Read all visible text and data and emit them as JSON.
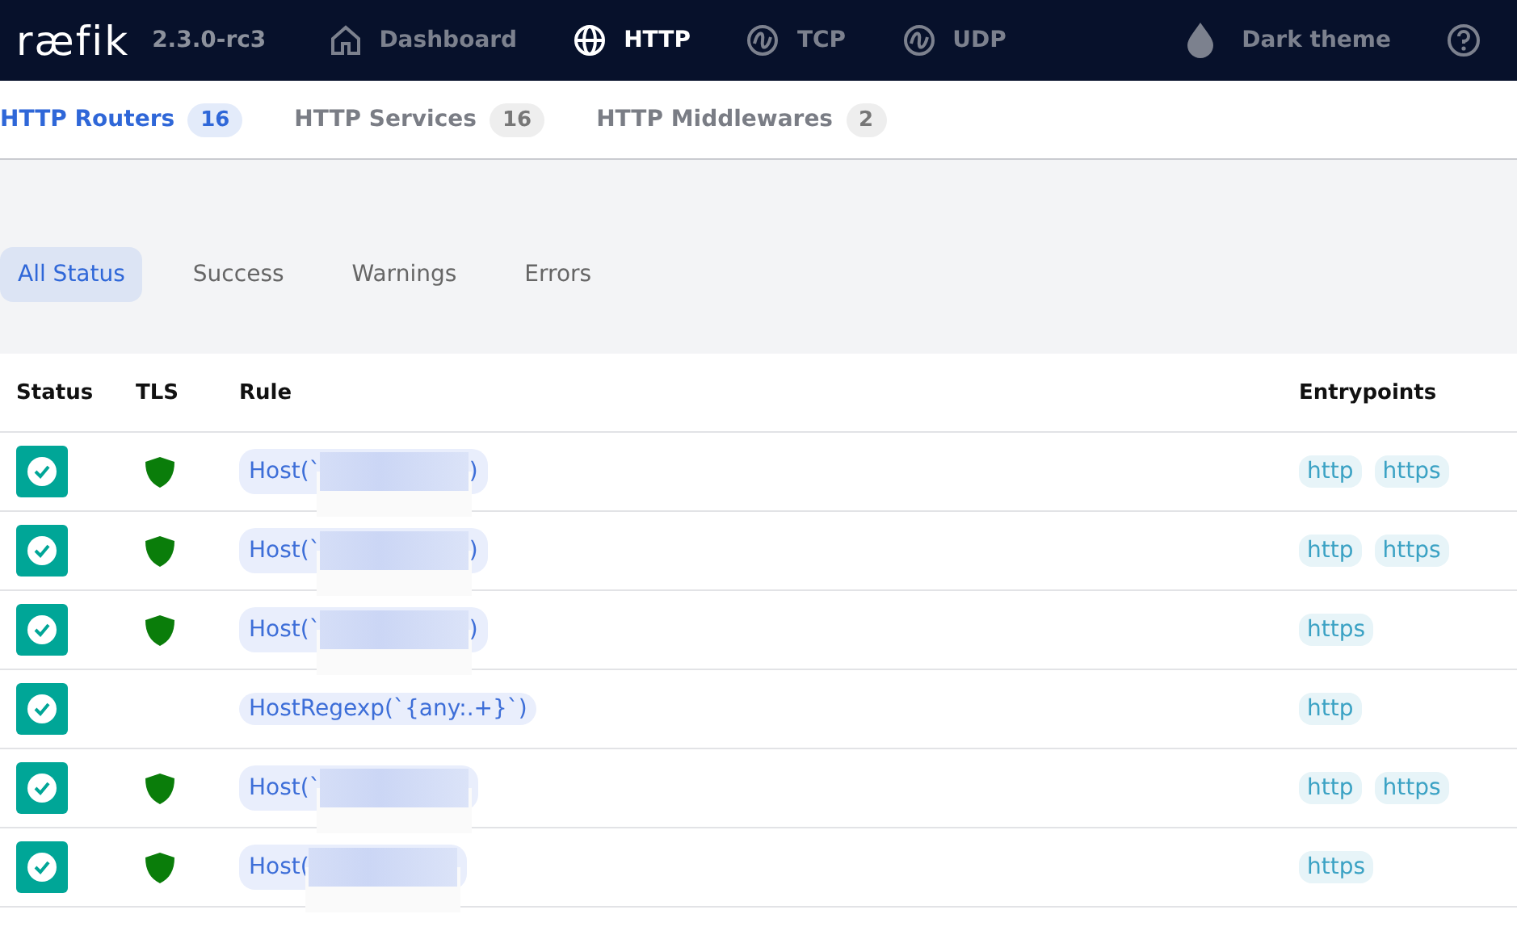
{
  "navbar": {
    "logo": "ræfik",
    "version": "2.3.0-rc3",
    "items": [
      {
        "label": "Dashboard",
        "selected": false
      },
      {
        "label": "HTTP",
        "selected": true
      },
      {
        "label": "TCP",
        "selected": false
      },
      {
        "label": "UDP",
        "selected": false
      }
    ],
    "theme_toggle": "Dark theme"
  },
  "subtabs": [
    {
      "label": "HTTP Routers",
      "count": "16",
      "selected": true
    },
    {
      "label": "HTTP Services",
      "count": "16",
      "selected": false
    },
    {
      "label": "HTTP Middlewares",
      "count": "2",
      "selected": false
    }
  ],
  "filters": [
    {
      "label": "All Status",
      "selected": true
    },
    {
      "label": "Success",
      "selected": false
    },
    {
      "label": "Warnings",
      "selected": false
    },
    {
      "label": "Errors",
      "selected": false
    }
  ],
  "table": {
    "columns": [
      "Status",
      "TLS",
      "Rule",
      "Entrypoints"
    ],
    "rows": [
      {
        "success": true,
        "tls": true,
        "rule": "Host(`",
        "redacted": true,
        "rule_end": ")",
        "entrypoints": [
          "http",
          "https"
        ]
      },
      {
        "success": true,
        "tls": true,
        "rule": "Host(`",
        "redacted": true,
        "rule_end": ")",
        "entrypoints": [
          "http",
          "https"
        ]
      },
      {
        "success": true,
        "tls": true,
        "rule": "Host(`",
        "redacted": true,
        "rule_end": ")",
        "entrypoints": [
          "https"
        ]
      },
      {
        "success": true,
        "tls": false,
        "rule": "HostRegexp(`{any:.+}`)",
        "redacted": false,
        "entrypoints": [
          "http"
        ]
      },
      {
        "success": true,
        "tls": true,
        "rule": "Host(`",
        "redacted": true,
        "entrypoints": [
          "http",
          "https"
        ]
      },
      {
        "success": true,
        "tls": true,
        "rule": "Host(",
        "redacted": true,
        "entrypoints": [
          "https"
        ]
      }
    ]
  }
}
